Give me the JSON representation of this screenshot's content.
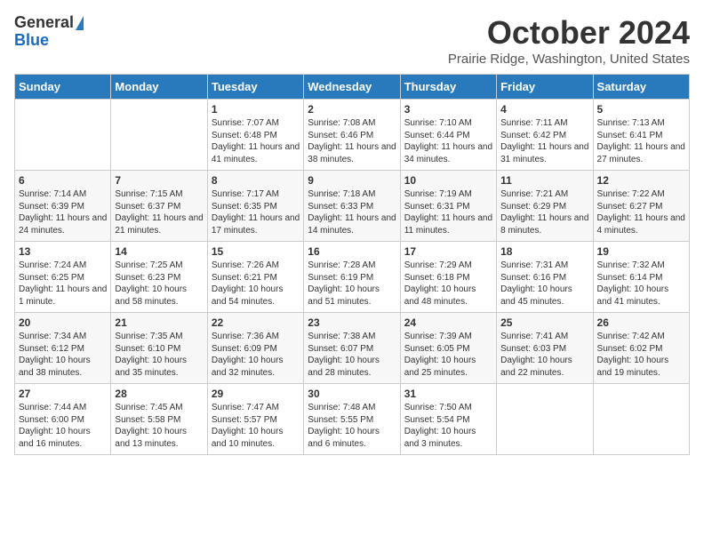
{
  "logo": {
    "general": "General",
    "blue": "Blue"
  },
  "title": "October 2024",
  "location": "Prairie Ridge, Washington, United States",
  "days_header": [
    "Sunday",
    "Monday",
    "Tuesday",
    "Wednesday",
    "Thursday",
    "Friday",
    "Saturday"
  ],
  "weeks": [
    [
      {
        "num": "",
        "text": ""
      },
      {
        "num": "",
        "text": ""
      },
      {
        "num": "1",
        "text": "Sunrise: 7:07 AM\nSunset: 6:48 PM\nDaylight: 11 hours and 41 minutes."
      },
      {
        "num": "2",
        "text": "Sunrise: 7:08 AM\nSunset: 6:46 PM\nDaylight: 11 hours and 38 minutes."
      },
      {
        "num": "3",
        "text": "Sunrise: 7:10 AM\nSunset: 6:44 PM\nDaylight: 11 hours and 34 minutes."
      },
      {
        "num": "4",
        "text": "Sunrise: 7:11 AM\nSunset: 6:42 PM\nDaylight: 11 hours and 31 minutes."
      },
      {
        "num": "5",
        "text": "Sunrise: 7:13 AM\nSunset: 6:41 PM\nDaylight: 11 hours and 27 minutes."
      }
    ],
    [
      {
        "num": "6",
        "text": "Sunrise: 7:14 AM\nSunset: 6:39 PM\nDaylight: 11 hours and 24 minutes."
      },
      {
        "num": "7",
        "text": "Sunrise: 7:15 AM\nSunset: 6:37 PM\nDaylight: 11 hours and 21 minutes."
      },
      {
        "num": "8",
        "text": "Sunrise: 7:17 AM\nSunset: 6:35 PM\nDaylight: 11 hours and 17 minutes."
      },
      {
        "num": "9",
        "text": "Sunrise: 7:18 AM\nSunset: 6:33 PM\nDaylight: 11 hours and 14 minutes."
      },
      {
        "num": "10",
        "text": "Sunrise: 7:19 AM\nSunset: 6:31 PM\nDaylight: 11 hours and 11 minutes."
      },
      {
        "num": "11",
        "text": "Sunrise: 7:21 AM\nSunset: 6:29 PM\nDaylight: 11 hours and 8 minutes."
      },
      {
        "num": "12",
        "text": "Sunrise: 7:22 AM\nSunset: 6:27 PM\nDaylight: 11 hours and 4 minutes."
      }
    ],
    [
      {
        "num": "13",
        "text": "Sunrise: 7:24 AM\nSunset: 6:25 PM\nDaylight: 11 hours and 1 minute."
      },
      {
        "num": "14",
        "text": "Sunrise: 7:25 AM\nSunset: 6:23 PM\nDaylight: 10 hours and 58 minutes."
      },
      {
        "num": "15",
        "text": "Sunrise: 7:26 AM\nSunset: 6:21 PM\nDaylight: 10 hours and 54 minutes."
      },
      {
        "num": "16",
        "text": "Sunrise: 7:28 AM\nSunset: 6:19 PM\nDaylight: 10 hours and 51 minutes."
      },
      {
        "num": "17",
        "text": "Sunrise: 7:29 AM\nSunset: 6:18 PM\nDaylight: 10 hours and 48 minutes."
      },
      {
        "num": "18",
        "text": "Sunrise: 7:31 AM\nSunset: 6:16 PM\nDaylight: 10 hours and 45 minutes."
      },
      {
        "num": "19",
        "text": "Sunrise: 7:32 AM\nSunset: 6:14 PM\nDaylight: 10 hours and 41 minutes."
      }
    ],
    [
      {
        "num": "20",
        "text": "Sunrise: 7:34 AM\nSunset: 6:12 PM\nDaylight: 10 hours and 38 minutes."
      },
      {
        "num": "21",
        "text": "Sunrise: 7:35 AM\nSunset: 6:10 PM\nDaylight: 10 hours and 35 minutes."
      },
      {
        "num": "22",
        "text": "Sunrise: 7:36 AM\nSunset: 6:09 PM\nDaylight: 10 hours and 32 minutes."
      },
      {
        "num": "23",
        "text": "Sunrise: 7:38 AM\nSunset: 6:07 PM\nDaylight: 10 hours and 28 minutes."
      },
      {
        "num": "24",
        "text": "Sunrise: 7:39 AM\nSunset: 6:05 PM\nDaylight: 10 hours and 25 minutes."
      },
      {
        "num": "25",
        "text": "Sunrise: 7:41 AM\nSunset: 6:03 PM\nDaylight: 10 hours and 22 minutes."
      },
      {
        "num": "26",
        "text": "Sunrise: 7:42 AM\nSunset: 6:02 PM\nDaylight: 10 hours and 19 minutes."
      }
    ],
    [
      {
        "num": "27",
        "text": "Sunrise: 7:44 AM\nSunset: 6:00 PM\nDaylight: 10 hours and 16 minutes."
      },
      {
        "num": "28",
        "text": "Sunrise: 7:45 AM\nSunset: 5:58 PM\nDaylight: 10 hours and 13 minutes."
      },
      {
        "num": "29",
        "text": "Sunrise: 7:47 AM\nSunset: 5:57 PM\nDaylight: 10 hours and 10 minutes."
      },
      {
        "num": "30",
        "text": "Sunrise: 7:48 AM\nSunset: 5:55 PM\nDaylight: 10 hours and 6 minutes."
      },
      {
        "num": "31",
        "text": "Sunrise: 7:50 AM\nSunset: 5:54 PM\nDaylight: 10 hours and 3 minutes."
      },
      {
        "num": "",
        "text": ""
      },
      {
        "num": "",
        "text": ""
      }
    ]
  ]
}
